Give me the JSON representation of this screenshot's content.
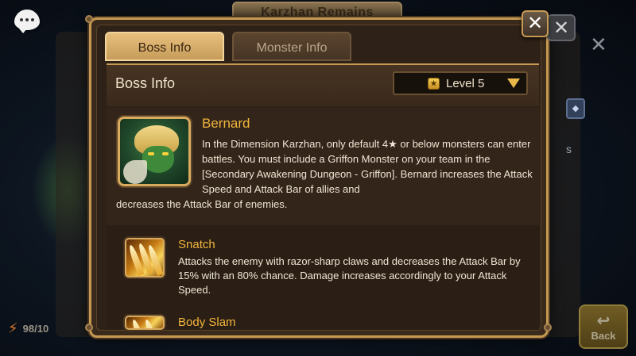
{
  "background": {
    "title_tab": "Karzhan Remains",
    "energy_text": "98/10",
    "back_label": "Back"
  },
  "dialog": {
    "tabs": [
      {
        "label": "Boss Info",
        "active": true
      },
      {
        "label": "Monster Info",
        "active": false
      }
    ],
    "section_title": "Boss Info",
    "level_select": {
      "value": "Level 5"
    },
    "boss": {
      "name": "Bernard",
      "description_line_a": "In the Dimension Karzhan, only default 4★ or below monsters can enter battles. You must include a Griffon Monster on your team in the [Secondary Awakening Dungeon - Griffon]. Bernard increases the Attack Speed and Attack Bar of allies and",
      "description_line_b": "decreases the Attack Bar of enemies."
    },
    "skills": [
      {
        "name": "Snatch",
        "description": "Attacks the enemy with razor-sharp claws and decreases the Attack Bar by 15% with an 80% chance. Damage increases accordingly to your Attack Speed."
      },
      {
        "name": "Body Slam",
        "description": ""
      }
    ]
  },
  "colors": {
    "frame_gold": "#c69a52",
    "name_gold": "#f2b53c",
    "active_tab": "#e7bf7c",
    "panel_brown": "#2e2117"
  }
}
